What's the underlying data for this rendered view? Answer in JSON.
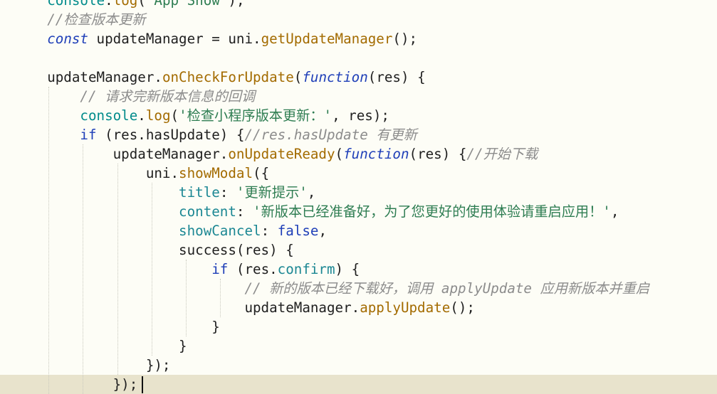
{
  "editor": {
    "lines": [
      [
        [
          "plain",
          "    "
        ],
        [
          "var",
          "console"
        ],
        [
          "punct",
          "."
        ],
        [
          "method",
          "log"
        ],
        [
          "punct",
          "("
        ],
        [
          "string",
          "'App Show'"
        ],
        [
          "punct",
          ");"
        ]
      ],
      [
        [
          "plain",
          "    "
        ],
        [
          "comment",
          "//检查版本更新"
        ]
      ],
      [
        [
          "plain",
          "    "
        ],
        [
          "keyword",
          "const"
        ],
        [
          "plain",
          " updateManager = uni."
        ],
        [
          "method",
          "getUpdateManager"
        ],
        [
          "punct",
          "();"
        ]
      ],
      [],
      [
        [
          "plain",
          "    updateManager."
        ],
        [
          "method",
          "onCheckForUpdate"
        ],
        [
          "punct",
          "("
        ],
        [
          "keyword",
          "function"
        ],
        [
          "punct",
          "(res) {"
        ]
      ],
      [
        [
          "plain",
          "        "
        ],
        [
          "comment",
          "// 请求完新版本信息的回调"
        ]
      ],
      [
        [
          "plain",
          "        "
        ],
        [
          "var",
          "console"
        ],
        [
          "punct",
          "."
        ],
        [
          "method",
          "log"
        ],
        [
          "punct",
          "("
        ],
        [
          "string",
          "'检查小程序版本更新：'"
        ],
        [
          "punct",
          ", res);"
        ]
      ],
      [
        [
          "plain",
          "        "
        ],
        [
          "control",
          "if"
        ],
        [
          "punct",
          " (res.hasUpdate) {"
        ],
        [
          "comment",
          "//res.hasUpdate 有更新"
        ]
      ],
      [
        [
          "plain",
          "            updateManager."
        ],
        [
          "method",
          "onUpdateReady"
        ],
        [
          "punct",
          "("
        ],
        [
          "keyword",
          "function"
        ],
        [
          "punct",
          "(res) {"
        ],
        [
          "comment",
          "//开始下载"
        ]
      ],
      [
        [
          "plain",
          "                uni."
        ],
        [
          "method",
          "showModal"
        ],
        [
          "punct",
          "({"
        ]
      ],
      [
        [
          "plain",
          "                    "
        ],
        [
          "prop",
          "title"
        ],
        [
          "punct",
          ": "
        ],
        [
          "string",
          "'更新提示'"
        ],
        [
          "punct",
          ","
        ]
      ],
      [
        [
          "plain",
          "                    "
        ],
        [
          "prop",
          "content"
        ],
        [
          "punct",
          ": "
        ],
        [
          "string",
          "'新版本已经准备好，为了您更好的使用体验请重启应用！'"
        ],
        [
          "punct",
          ","
        ]
      ],
      [
        [
          "plain",
          "                    "
        ],
        [
          "prop",
          "showCancel"
        ],
        [
          "punct",
          ": "
        ],
        [
          "bool",
          "false"
        ],
        [
          "punct",
          ","
        ]
      ],
      [
        [
          "plain",
          "                    success(res) {"
        ]
      ],
      [
        [
          "plain",
          "                        "
        ],
        [
          "control",
          "if"
        ],
        [
          "punct",
          " (res."
        ],
        [
          "prop",
          "confirm"
        ],
        [
          "punct",
          ") {"
        ]
      ],
      [
        [
          "plain",
          "                            "
        ],
        [
          "comment",
          "// 新的版本已经下载好，调用 applyUpdate 应用新版本并重启"
        ]
      ],
      [
        [
          "plain",
          "                            updateManager."
        ],
        [
          "method",
          "applyUpdate"
        ],
        [
          "punct",
          "();"
        ]
      ],
      [
        [
          "plain",
          "                        }"
        ]
      ],
      [
        [
          "plain",
          "                    }"
        ]
      ],
      [
        [
          "plain",
          "                });"
        ]
      ],
      [
        [
          "plain",
          "            });"
        ]
      ]
    ],
    "current_line": 20
  }
}
